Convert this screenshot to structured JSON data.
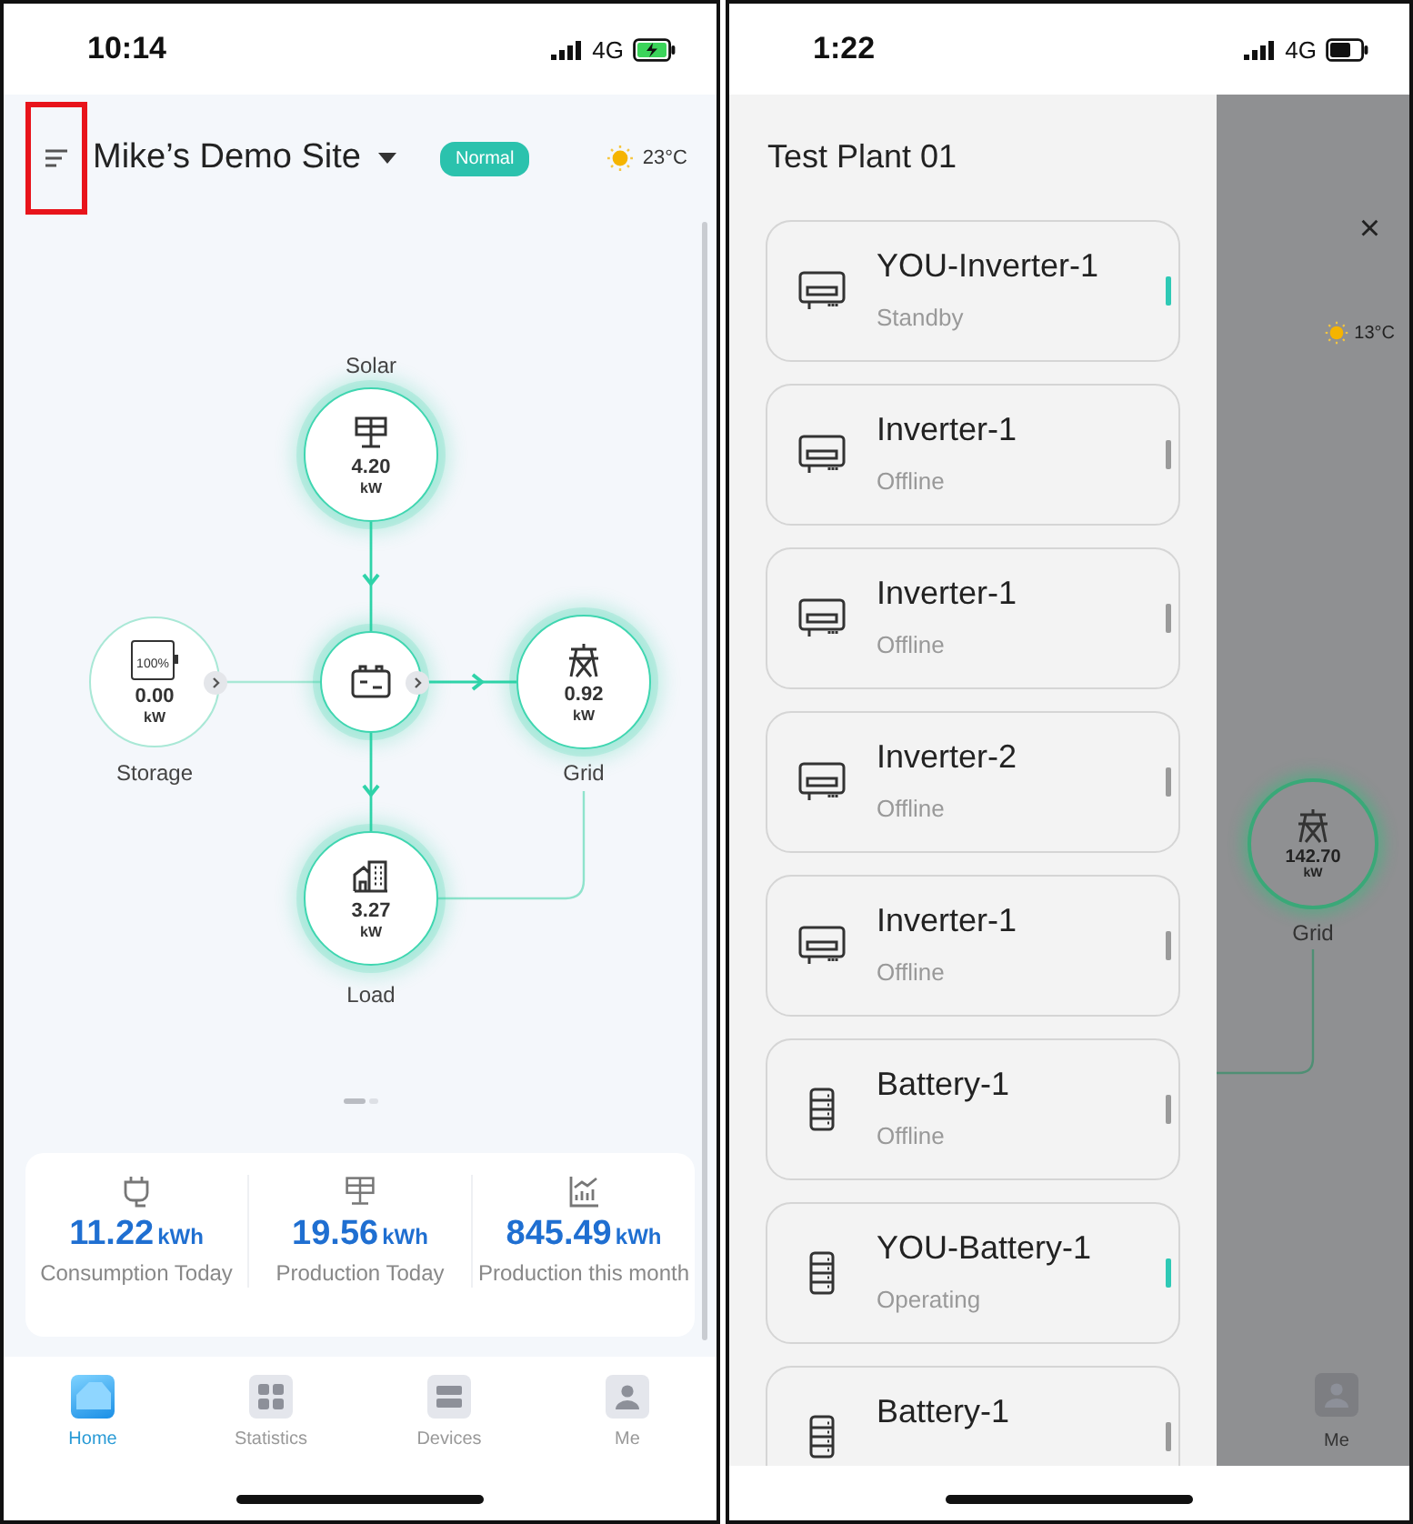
{
  "home_screen": {
    "status_bar": {
      "time": "10:14",
      "network": "4G",
      "battery_charging": true
    },
    "header": {
      "menu_highlighted": true,
      "site_name": "Mike’s Demo Site",
      "status_badge": "Normal",
      "temperature": "23°C"
    },
    "flow": {
      "nodes": [
        {
          "kind": "solar",
          "label": "Solar",
          "value": "4.20",
          "unit": "kW",
          "active": true
        },
        {
          "kind": "storage",
          "label": "Storage",
          "value": "0.00",
          "unit": "kW",
          "battery_text": "100%",
          "active": false
        },
        {
          "kind": "hub",
          "active": true
        },
        {
          "kind": "grid",
          "label": "Grid",
          "value": "0.92",
          "unit": "kW",
          "active": true
        },
        {
          "kind": "load",
          "label": "Load",
          "value": "3.27",
          "unit": "kW",
          "active": true
        }
      ]
    },
    "pager": [
      {
        "selected": true
      },
      {
        "selected": false
      }
    ],
    "stats": [
      {
        "kind": "consumption",
        "value": "11.22",
        "unit": "kWh",
        "label": "Consumption Today"
      },
      {
        "kind": "production",
        "value": "19.56",
        "unit": "kWh",
        "label": "Production Today"
      },
      {
        "kind": "month",
        "value": "845.49",
        "unit": "kWh",
        "label": "Production this month"
      }
    ],
    "tabs": [
      {
        "kind": "home",
        "label": "Home",
        "selected": true
      },
      {
        "kind": "statistics",
        "label": "Statistics",
        "selected": false
      },
      {
        "kind": "devices",
        "label": "Devices",
        "selected": false
      },
      {
        "kind": "me",
        "label": "Me",
        "selected": false
      }
    ]
  },
  "drawer_screen": {
    "status_bar": {
      "time": "1:22",
      "network": "4G",
      "battery_charging": false
    },
    "drawer": {
      "title": "Test Plant 01",
      "devices": [
        {
          "kind": "inverter",
          "name": "YOU-Inverter-1",
          "status": "Standby",
          "active": true
        },
        {
          "kind": "inverter",
          "name": "Inverter-1",
          "status": "Offline",
          "active": false
        },
        {
          "kind": "inverter",
          "name": "Inverter-1",
          "status": "Offline",
          "active": false
        },
        {
          "kind": "inverter",
          "name": "Inverter-2",
          "status": "Offline",
          "active": false
        },
        {
          "kind": "inverter",
          "name": "Inverter-1",
          "status": "Offline",
          "active": false
        },
        {
          "kind": "battery",
          "name": "Battery-1",
          "status": "Offline",
          "active": false
        },
        {
          "kind": "battery",
          "name": "YOU-Battery-1",
          "status": "Operating",
          "active": true
        },
        {
          "kind": "battery",
          "name": "Battery-1",
          "active": false
        }
      ]
    },
    "background": {
      "close_glyph": "×",
      "temperature": "13°C",
      "grid_node": {
        "value": "142.70",
        "unit": "kW",
        "label": "Grid"
      },
      "tab_label": "Me"
    }
  }
}
